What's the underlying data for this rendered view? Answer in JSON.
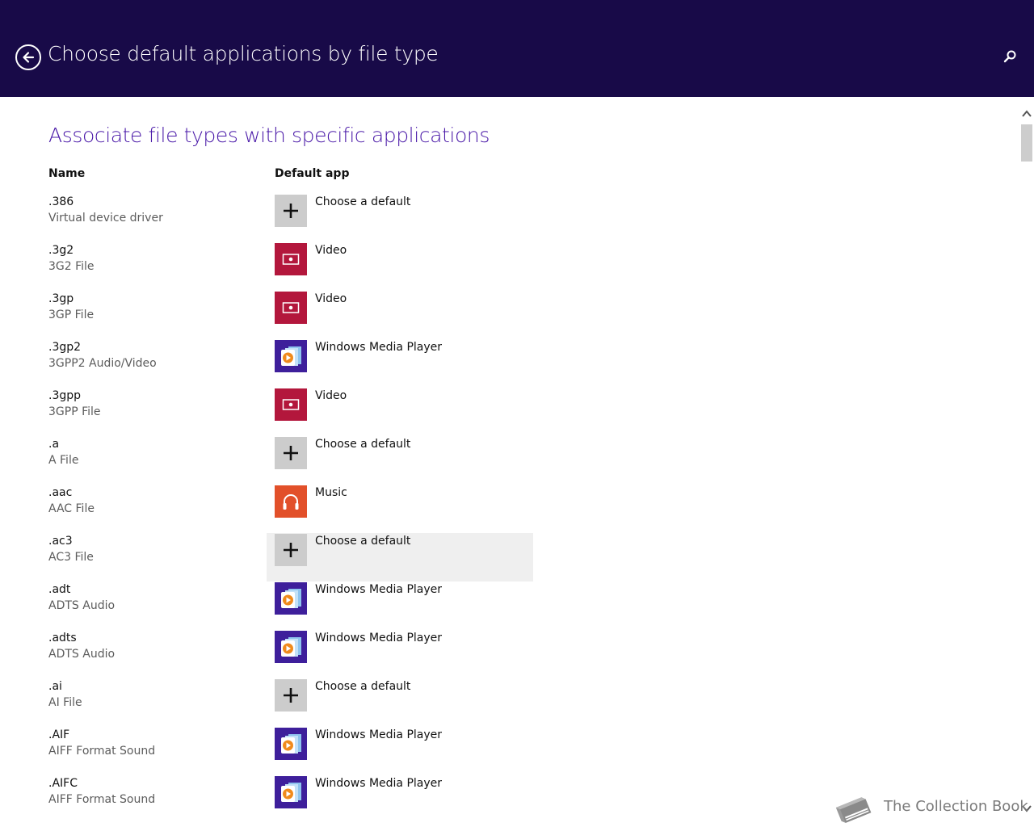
{
  "header": {
    "title": "Choose default applications by file type",
    "back_icon": "back-arrow-icon",
    "search_icon": "search-icon",
    "background": "#180a48"
  },
  "main": {
    "section_title": "Associate file types with specific applications",
    "columns": {
      "name": "Name",
      "default_app": "Default app"
    },
    "rows": [
      {
        "ext": ".386",
        "desc": "Virtual device driver",
        "app": "Choose a default",
        "icon": "plus-icon"
      },
      {
        "ext": ".3g2",
        "desc": "3G2 File",
        "app": "Video",
        "icon": "video-icon"
      },
      {
        "ext": ".3gp",
        "desc": "3GP File",
        "app": "Video",
        "icon": "video-icon"
      },
      {
        "ext": ".3gp2",
        "desc": "3GPP2 Audio/Video",
        "app": "Windows Media Player",
        "icon": "windows-media-player-icon"
      },
      {
        "ext": ".3gpp",
        "desc": "3GPP File",
        "app": "Video",
        "icon": "video-icon"
      },
      {
        "ext": ".a",
        "desc": "A File",
        "app": "Choose a default",
        "icon": "plus-icon"
      },
      {
        "ext": ".aac",
        "desc": "AAC File",
        "app": "Music",
        "icon": "music-icon"
      },
      {
        "ext": ".ac3",
        "desc": "AC3 File",
        "app": "Choose a default",
        "icon": "plus-icon",
        "hovered": true
      },
      {
        "ext": ".adt",
        "desc": "ADTS Audio",
        "app": "Windows Media Player",
        "icon": "windows-media-player-icon"
      },
      {
        "ext": ".adts",
        "desc": "ADTS Audio",
        "app": "Windows Media Player",
        "icon": "windows-media-player-icon"
      },
      {
        "ext": ".ai",
        "desc": "AI File",
        "app": "Choose a default",
        "icon": "plus-icon"
      },
      {
        "ext": ".AIF",
        "desc": "AIFF Format Sound",
        "app": "Windows Media Player",
        "icon": "windows-media-player-icon"
      },
      {
        "ext": ".AIFC",
        "desc": "AIFF Format Sound",
        "app": "Windows Media Player",
        "icon": "windows-media-player-icon"
      }
    ]
  },
  "colors": {
    "accent": "#4a19a8",
    "video": "#b3173c",
    "windows_media_player": "#3e1f9b",
    "music": "#e2502a",
    "choose_default": "#cccccc"
  },
  "watermark": {
    "text": "The Collection Book",
    "icon": "book-icon"
  }
}
